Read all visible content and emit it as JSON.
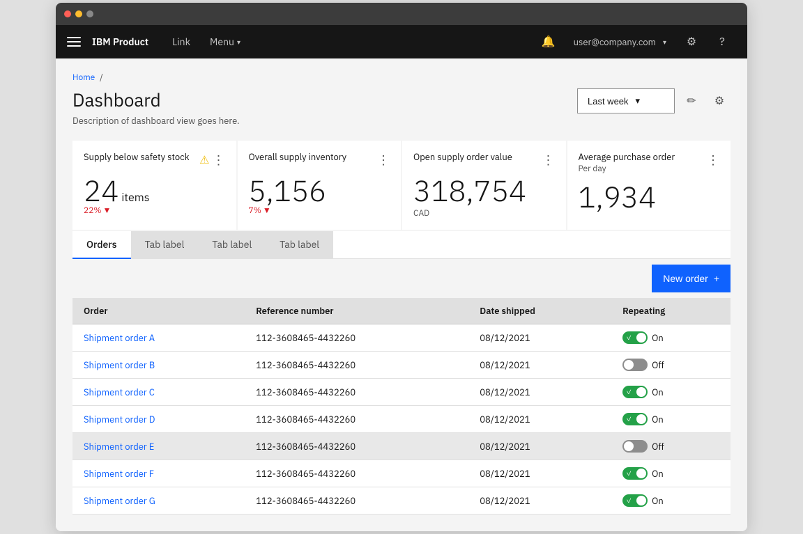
{
  "browser": {
    "dots": [
      "red",
      "yellow",
      "gray"
    ]
  },
  "nav": {
    "brand": "IBM Product",
    "links": [
      {
        "label": "Link"
      },
      {
        "label": "Menu"
      }
    ],
    "user_email": "user@company.com",
    "icons": {
      "bell": "🔔",
      "settings": "⚙",
      "help": "?"
    }
  },
  "breadcrumb": {
    "home": "Home",
    "separator": "/"
  },
  "header": {
    "title": "Dashboard",
    "description": "Description of dashboard view goes here.",
    "date_range": "Last week",
    "edit_icon": "✏",
    "settings_icon": "⚙"
  },
  "stats": [
    {
      "title": "Supply below safety stock",
      "has_warning": true,
      "value": "24",
      "unit": "items",
      "trend": "22%",
      "trend_down": true,
      "secondary_label": ""
    },
    {
      "title": "Overall supply inventory",
      "has_warning": false,
      "value": "5,156",
      "unit": "",
      "trend": "7%",
      "trend_down": true,
      "secondary_label": ""
    },
    {
      "title": "Open supply order value",
      "has_warning": false,
      "value": "318,754",
      "unit": "",
      "trend": "",
      "trend_down": false,
      "secondary_label": "CAD"
    },
    {
      "title": "Average purchase order",
      "has_warning": false,
      "value": "1,934",
      "unit": "",
      "trend": "",
      "trend_down": false,
      "secondary_label": "Per day"
    }
  ],
  "tabs": [
    {
      "label": "Orders",
      "active": true
    },
    {
      "label": "Tab label",
      "active": false
    },
    {
      "label": "Tab label",
      "active": false
    },
    {
      "label": "Tab label",
      "active": false
    }
  ],
  "table": {
    "toolbar": {
      "new_order_label": "New order",
      "new_order_icon": "+"
    },
    "columns": [
      "Order",
      "Reference number",
      "Date shipped",
      "Repeating"
    ],
    "rows": [
      {
        "order": "Shipment order A",
        "ref": "112-3608465-4432260",
        "date": "08/12/2021",
        "repeating": true,
        "highlighted": false
      },
      {
        "order": "Shipment order B",
        "ref": "112-3608465-4432260",
        "date": "08/12/2021",
        "repeating": false,
        "highlighted": false
      },
      {
        "order": "Shipment order C",
        "ref": "112-3608465-4432260",
        "date": "08/12/2021",
        "repeating": true,
        "highlighted": false
      },
      {
        "order": "Shipment order D",
        "ref": "112-3608465-4432260",
        "date": "08/12/2021",
        "repeating": true,
        "highlighted": false
      },
      {
        "order": "Shipment order E",
        "ref": "112-3608465-4432260",
        "date": "08/12/2021",
        "repeating": false,
        "highlighted": true
      },
      {
        "order": "Shipment order F",
        "ref": "112-3608465-4432260",
        "date": "08/12/2021",
        "repeating": true,
        "highlighted": false
      },
      {
        "order": "Shipment order G",
        "ref": "112-3608465-4432260",
        "date": "08/12/2021",
        "repeating": true,
        "highlighted": false
      }
    ]
  }
}
